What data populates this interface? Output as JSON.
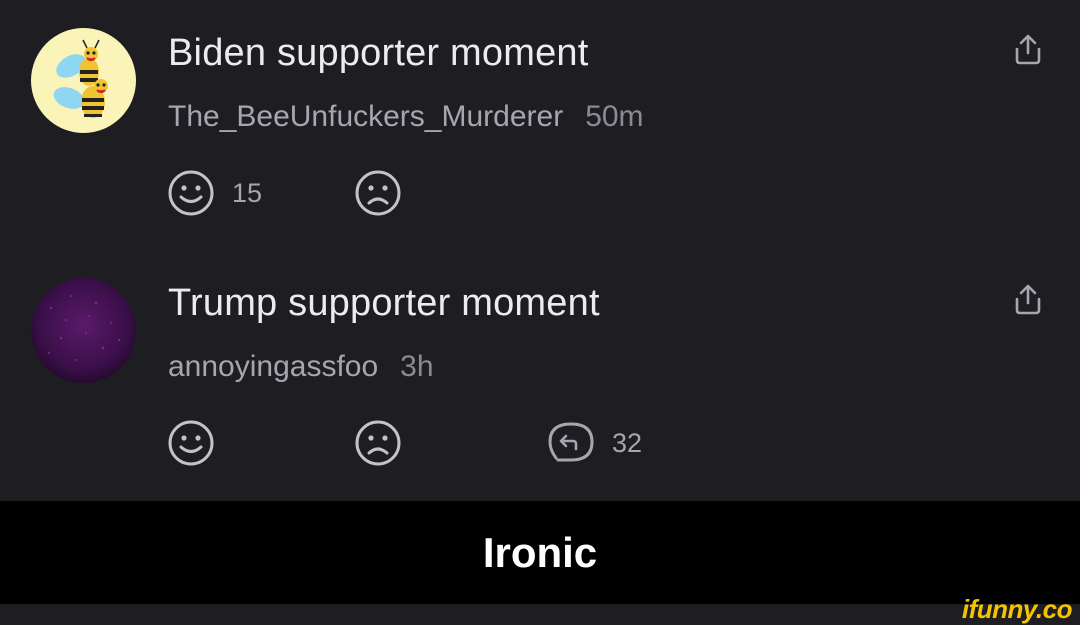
{
  "posts": [
    {
      "title": "Biden supporter moment",
      "username": "The_BeeUnfuckers_Murderer",
      "time": "50m",
      "avatar_icon": "bees-avatar",
      "like_count": "15",
      "dislike_count": "",
      "reply_count": ""
    },
    {
      "title": "Trump supporter moment",
      "username": "annoyingassfoo",
      "time": "3h",
      "avatar_icon": "purple-sparkle-avatar",
      "like_count": "",
      "dislike_count": "",
      "reply_count": "32"
    }
  ],
  "caption": "Ironic",
  "watermark": "ifunny.co",
  "colors": {
    "background": "#1d1d22",
    "text_primary": "#ececf0",
    "text_secondary": "#a6a6ae",
    "caption_bar": "#000000",
    "watermark": "#f5c400"
  }
}
